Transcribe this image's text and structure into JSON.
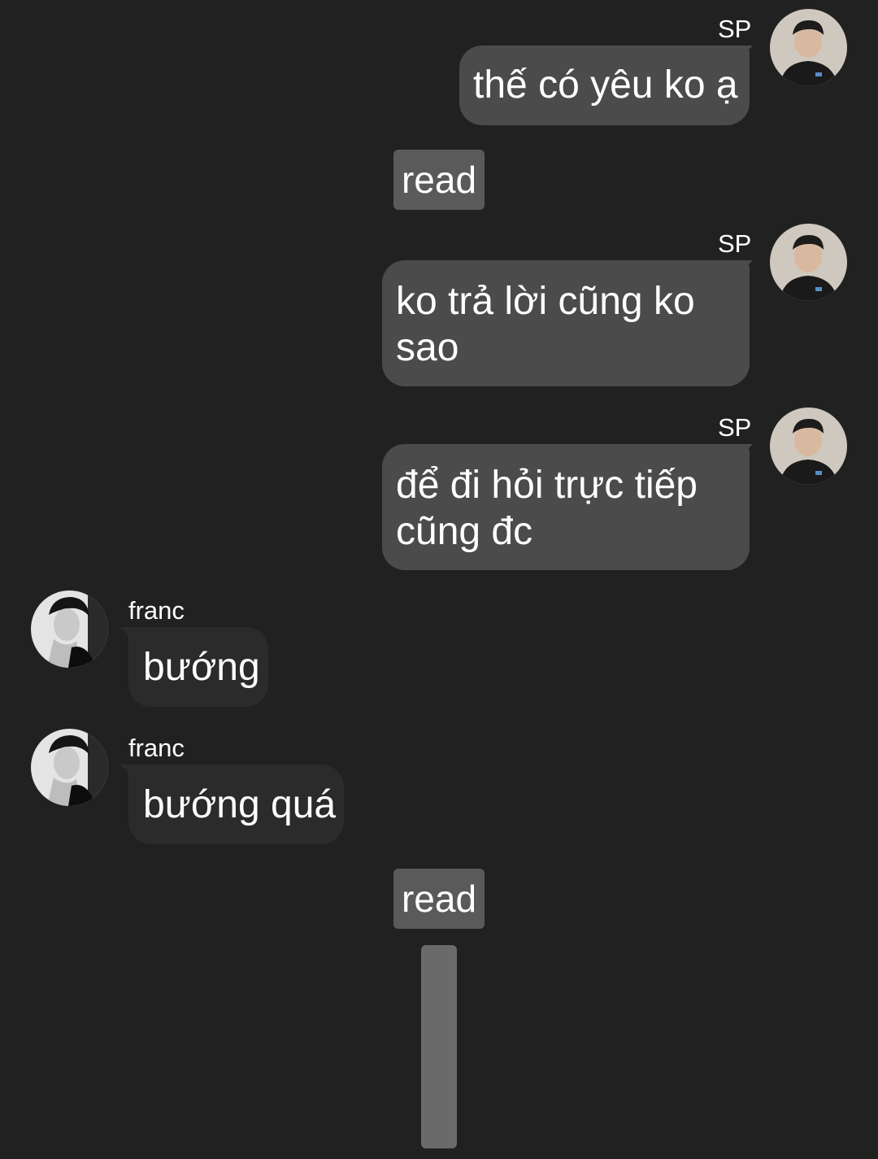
{
  "app": "chat-conversation",
  "colors": {
    "background": "#212121",
    "sent_bubble": "#4b4b4b",
    "received_bubble": "#2b2b2b",
    "status_badge": "#5a5a5a",
    "scrollbar": "#6a6a6a",
    "text": "#ffffff"
  },
  "messages": [
    {
      "sender": "SP",
      "side": "right",
      "text": "thế có yêu ko ạ",
      "avatar_icon": "user-avatar-icon"
    },
    {
      "status": "read"
    },
    {
      "sender": "SP",
      "side": "right",
      "lines": [
        "ko trả lời cũng ko",
        "sao"
      ],
      "avatar_icon": "user-avatar-icon"
    },
    {
      "sender": "SP",
      "side": "right",
      "lines": [
        "để đi hỏi trực tiếp",
        "cũng đc"
      ],
      "avatar_icon": "user-avatar-icon"
    },
    {
      "sender": "franc",
      "side": "left",
      "text": "bướng",
      "avatar_icon": "user-avatar-icon"
    },
    {
      "sender": "franc",
      "side": "left",
      "text": "bướng quá",
      "avatar_icon": "user-avatar-icon"
    },
    {
      "status": "read"
    }
  ]
}
